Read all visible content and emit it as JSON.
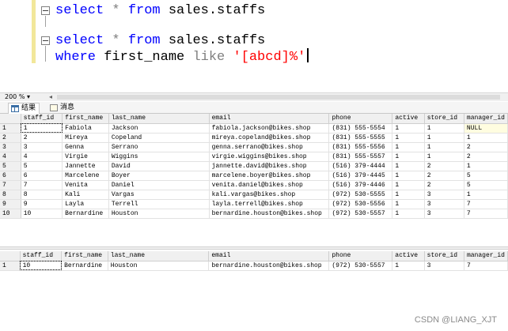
{
  "editor": {
    "lines": [
      {
        "tokens": [
          {
            "t": "select",
            "c": "kw"
          },
          {
            "t": " "
          },
          {
            "t": "*",
            "c": "op"
          },
          {
            "t": " "
          },
          {
            "t": "from",
            "c": "kw"
          },
          {
            "t": " sales.staffs"
          }
        ]
      },
      {
        "tokens": [
          {
            "t": "select",
            "c": "kw"
          },
          {
            "t": " "
          },
          {
            "t": "*",
            "c": "op"
          },
          {
            "t": " "
          },
          {
            "t": "from",
            "c": "kw"
          },
          {
            "t": " sales.staffs"
          }
        ]
      },
      {
        "tokens": [
          {
            "t": "where",
            "c": "kw"
          },
          {
            "t": " first_name "
          },
          {
            "t": "like",
            "c": "op"
          },
          {
            "t": " "
          },
          {
            "t": "'[abcd]%'",
            "c": "str"
          }
        ]
      }
    ]
  },
  "zoom": {
    "level": "200 %",
    "dropdown_arrow": "▾",
    "scroll_left_arrow": "◂"
  },
  "tabs": [
    {
      "label": "结果",
      "icon": "results-grid-icon",
      "active": true
    },
    {
      "label": "消息",
      "icon": "messages-icon",
      "active": false
    }
  ],
  "colors": {
    "keyword": "#0000ff",
    "operator": "#808080",
    "string": "#ff0000",
    "margin_marker": "#f2e79a"
  },
  "columns": [
    "staff_id",
    "first_name",
    "last_name",
    "email",
    "phone",
    "active",
    "store_id",
    "manager_id"
  ],
  "grid1": {
    "rows": [
      {
        "n": "1",
        "cells": [
          "1",
          "Fabiola",
          "Jackson",
          "fabiola.jackson@bikes.shop",
          "(831) 555-5554",
          "1",
          "1",
          "NULL"
        ]
      },
      {
        "n": "2",
        "cells": [
          "2",
          "Mireya",
          "Copeland",
          "mireya.copeland@bikes.shop",
          "(831) 555-5555",
          "1",
          "1",
          "1"
        ]
      },
      {
        "n": "3",
        "cells": [
          "3",
          "Genna",
          "Serrano",
          "genna.serrano@bikes.shop",
          "(831) 555-5556",
          "1",
          "1",
          "2"
        ]
      },
      {
        "n": "4",
        "cells": [
          "4",
          "Virgie",
          "Wiggins",
          "virgie.wiggins@bikes.shop",
          "(831) 555-5557",
          "1",
          "1",
          "2"
        ]
      },
      {
        "n": "5",
        "cells": [
          "5",
          "Jannette",
          "David",
          "jannette.david@bikes.shop",
          "(516) 379-4444",
          "1",
          "2",
          "1"
        ]
      },
      {
        "n": "6",
        "cells": [
          "6",
          "Marcelene",
          "Boyer",
          "marcelene.boyer@bikes.shop",
          "(516) 379-4445",
          "1",
          "2",
          "5"
        ]
      },
      {
        "n": "7",
        "cells": [
          "7",
          "Venita",
          "Daniel",
          "venita.daniel@bikes.shop",
          "(516) 379-4446",
          "1",
          "2",
          "5"
        ]
      },
      {
        "n": "8",
        "cells": [
          "8",
          "Kali",
          "Vargas",
          "kali.vargas@bikes.shop",
          "(972) 530-5555",
          "1",
          "3",
          "1"
        ]
      },
      {
        "n": "9",
        "cells": [
          "9",
          "Layla",
          "Terrell",
          "layla.terrell@bikes.shop",
          "(972) 530-5556",
          "1",
          "3",
          "7"
        ]
      },
      {
        "n": "10",
        "cells": [
          "10",
          "Bernardine",
          "Houston",
          "bernardine.houston@bikes.shop",
          "(972) 530-5557",
          "1",
          "3",
          "7"
        ]
      }
    ]
  },
  "grid2": {
    "rows": [
      {
        "n": "1",
        "cells": [
          "10",
          "Bernardine",
          "Houston",
          "bernardine.houston@bikes.shop",
          "(972) 530-5557",
          "1",
          "3",
          "7"
        ]
      }
    ]
  },
  "watermark": "CSDN @LIANG_XJT"
}
